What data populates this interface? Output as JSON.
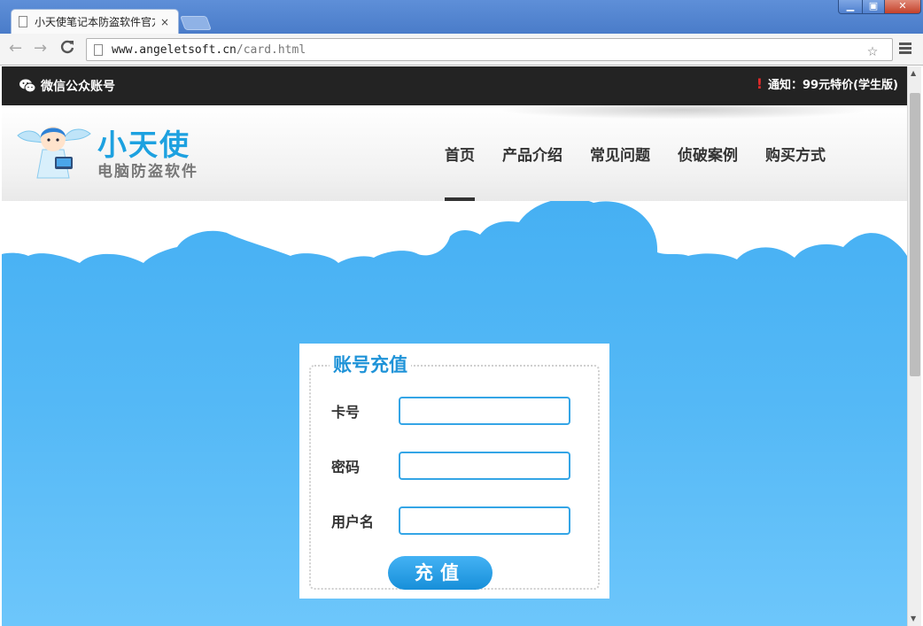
{
  "browser": {
    "tab_title": "小天使笔记本防盗软件官方",
    "tab_close": "×",
    "url_host": "www.angeletsoft.cn",
    "url_path": "/card.html",
    "back": "←",
    "forward": "→",
    "reload": "C",
    "bookmark": "☆",
    "win_minimize": "▁",
    "win_maximize": "▣",
    "win_close": "✕"
  },
  "topbar": {
    "wechat_label": "微信公众账号",
    "alert_glyph": "!",
    "notice": "通知：99元特价(学生版)"
  },
  "logo": {
    "title": "小天使",
    "subtitle": "电脑防盗软件"
  },
  "nav": {
    "items": [
      {
        "label": "首页",
        "active": true
      },
      {
        "label": "产品介绍"
      },
      {
        "label": "常见问题"
      },
      {
        "label": "侦破案例"
      },
      {
        "label": "购买方式"
      }
    ]
  },
  "form": {
    "legend": "账号充值",
    "card_label": "卡号",
    "card_value": "",
    "password_label": "密码",
    "password_value": "",
    "username_label": "用户名",
    "username_value": "",
    "submit_label": "充值"
  },
  "colors": {
    "accent": "#1da1e0",
    "sky": "#46b0f3",
    "topbar": "#232323"
  },
  "icons": [
    "document-icon",
    "back-icon",
    "forward-icon",
    "reload-icon",
    "page-icon",
    "star-icon",
    "menu-icon",
    "wechat-icon",
    "alert-icon",
    "angel-logo"
  ]
}
